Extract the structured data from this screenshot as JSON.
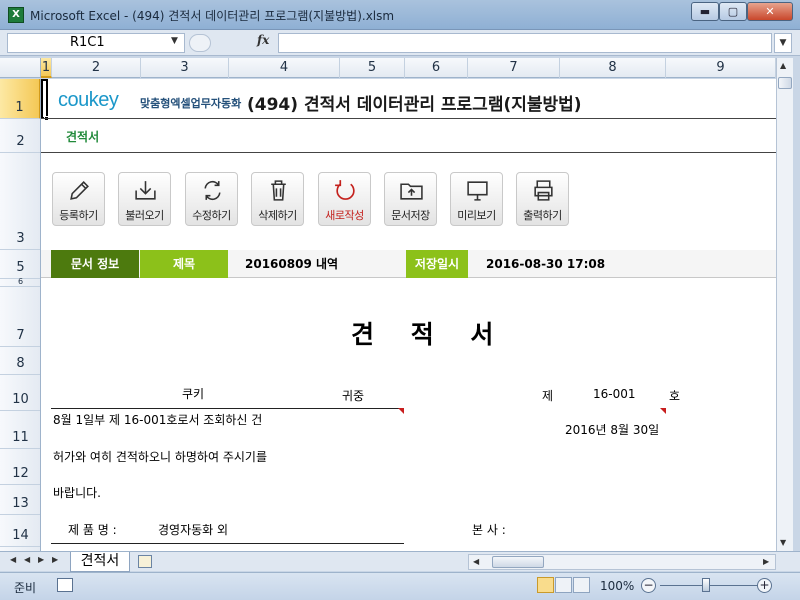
{
  "window": {
    "title": "Microsoft Excel - (494) 견적서 데이터관리 프로그램(지불방법).xlsm",
    "app_icon": "X",
    "minimize": "▬",
    "maximize": "▢",
    "close": "✕"
  },
  "formula_bar": {
    "name_box": "R1C1",
    "fx": "fx"
  },
  "columns": [
    "1",
    "2",
    "3",
    "4",
    "5",
    "6",
    "7",
    "8",
    "9"
  ],
  "rows": [
    "1",
    "2",
    "3",
    "5",
    "6",
    "7",
    "8",
    "10",
    "11",
    "12",
    "13",
    "14"
  ],
  "header": {
    "logo": "coukey",
    "tagline": "맞춤형엑셀업무자동화",
    "program_title": "(494) 견적서 데이터관리 프로그램(지불방법)",
    "doc_kind": "견적서"
  },
  "toolbar": [
    {
      "label": "등록하기",
      "icon": "pencil-icon"
    },
    {
      "label": "불러오기",
      "icon": "download-icon"
    },
    {
      "label": "수정하기",
      "icon": "refresh-icon"
    },
    {
      "label": "삭제하기",
      "icon": "trash-icon"
    },
    {
      "label": "새로작성",
      "icon": "new-icon"
    },
    {
      "label": "문서저장",
      "icon": "folder-save-icon"
    },
    {
      "label": "미리보기",
      "icon": "monitor-icon"
    },
    {
      "label": "출력하기",
      "icon": "printer-icon"
    }
  ],
  "info": {
    "doc_info_label": "문서 정보",
    "subject_label": "제목",
    "subject_value": "20160809 내역",
    "saved_label": "저장일시",
    "saved_value": "2016-08-30 17:08"
  },
  "document": {
    "title": "견 적 서",
    "recipient": "쿠키",
    "honorific": "귀중",
    "number_prefix": "제",
    "number": "16-001",
    "number_suffix": "호",
    "line1": "8월 1일부 제 16-001호로서 조회하신 건",
    "date": "2016년 8월 30일",
    "line2": "허가와 여히 견적하오니 하명하여 주시기를",
    "line3": "바랍니다.",
    "product_label": "제 품 명 :",
    "product_value": "경영자동화 외",
    "office_label": "본    사 :"
  },
  "tabs": {
    "sheet_name": "견적서"
  },
  "status": {
    "ready": "준비",
    "zoom": "100%",
    "zoom_out": "−",
    "zoom_in": "+"
  }
}
